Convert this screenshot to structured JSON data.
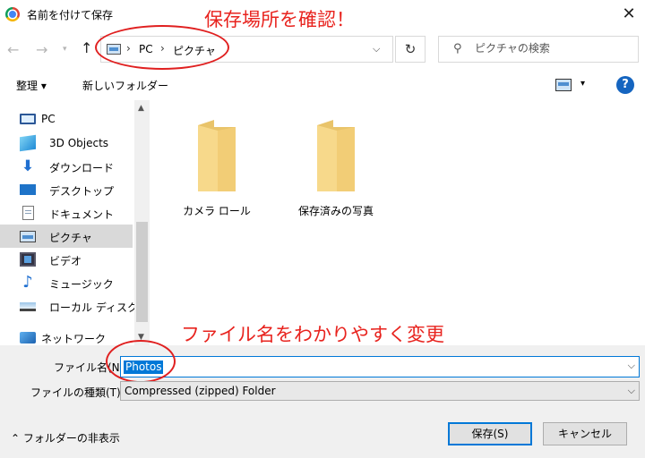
{
  "window": {
    "title": "名前を付けて保存",
    "close_glyph": "✕"
  },
  "nav": {
    "back_glyph": "←",
    "forward_glyph": "→",
    "recent_glyph": "▾",
    "up_glyph": "↑"
  },
  "address": {
    "separator": "›",
    "segments": [
      "PC",
      "ピクチャ"
    ],
    "dropdown_glyph": "⌵"
  },
  "refresh_glyph": "↻",
  "search": {
    "placeholder": "ピクチャの検索",
    "icon_glyph": "⚲"
  },
  "annotations": {
    "top": "保存場所を確認！",
    "middle": "ファイル名をわかりやすく変更",
    "color": "#e8231e"
  },
  "toolbar": {
    "organize_label": "整理 ▾",
    "new_folder_label": "新しいフォルダー",
    "view_caret": "▾",
    "help_label": "?"
  },
  "sidebar": {
    "items": [
      {
        "label": "PC",
        "icon": "monitor-icon"
      },
      {
        "label": "3D Objects",
        "icon": "cube-icon"
      },
      {
        "label": "ダウンロード",
        "icon": "download-icon"
      },
      {
        "label": "デスクトップ",
        "icon": "desktop-icon"
      },
      {
        "label": "ドキュメント",
        "icon": "document-icon"
      },
      {
        "label": "ピクチャ",
        "icon": "pictures-icon",
        "selected": true
      },
      {
        "label": "ビデオ",
        "icon": "video-icon"
      },
      {
        "label": "ミュージック",
        "icon": "music-icon"
      },
      {
        "label": "ローカル ディスク (C",
        "icon": "drive-icon"
      },
      {
        "label": "ネットワーク",
        "icon": "network-icon"
      }
    ],
    "scroll_up_glyph": "▲",
    "scroll_down_glyph": "▼"
  },
  "content": {
    "folders": [
      {
        "label": "カメラ ロール"
      },
      {
        "label": "保存済みの写真"
      }
    ]
  },
  "form": {
    "filename_label": "ファイル名(N):",
    "filename_value": "Photos",
    "filetype_label": "ファイルの種類(T):",
    "filetype_value": "Compressed (zipped) Folder",
    "caret_glyph": "⌵",
    "hide_folders_label": "⌃ フォルダーの非表示",
    "save_label": "保存(S)",
    "cancel_label": "キャンセル"
  }
}
